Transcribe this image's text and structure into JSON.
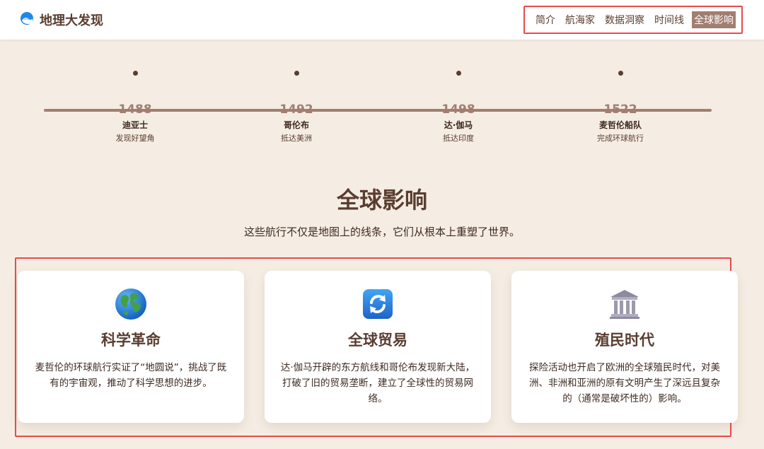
{
  "header": {
    "brand_title": "地理大发现",
    "nav": [
      "简介",
      "航海家",
      "数据洞察",
      "时间线",
      "全球影响"
    ],
    "active_nav": "全球影响"
  },
  "timeline": [
    {
      "year": "1488",
      "name": "迪亚士",
      "desc": "发现好望角"
    },
    {
      "year": "1492",
      "name": "哥伦布",
      "desc": "抵达美洲"
    },
    {
      "year": "1498",
      "name": "达·伽马",
      "desc": "抵达印度"
    },
    {
      "year": "1522",
      "name": "麦哲伦船队",
      "desc": "完成环球航行"
    }
  ],
  "section": {
    "title": "全球影响",
    "subtitle": "这些航行不仅是地图上的线条，它们从根本上重塑了世界。"
  },
  "cards": [
    {
      "icon": "globe-icon",
      "title": "科学革命",
      "text": "麦哲伦的环球航行实证了“地圆说”，挑战了既有的宇宙观，推动了科学思想的进步。"
    },
    {
      "icon": "refresh-icon",
      "title": "全球贸易",
      "text": "达·伽马开辟的东方航线和哥伦布发现新大陆，打破了旧的贸易垄断，建立了全球性的贸易网络。"
    },
    {
      "icon": "classical-building-icon",
      "title": "殖民时代",
      "text": "探险活动也开启了欧洲的全球殖民时代，对美洲、非洲和亚洲的原有文明产生了深远且复杂的（通常是破坏性的）影响。"
    }
  ],
  "colors": {
    "background": "#f5ede3",
    "primary_brown": "#5a3d30",
    "accent_brown": "#a27e6f",
    "highlight_red": "#e94b4b"
  }
}
